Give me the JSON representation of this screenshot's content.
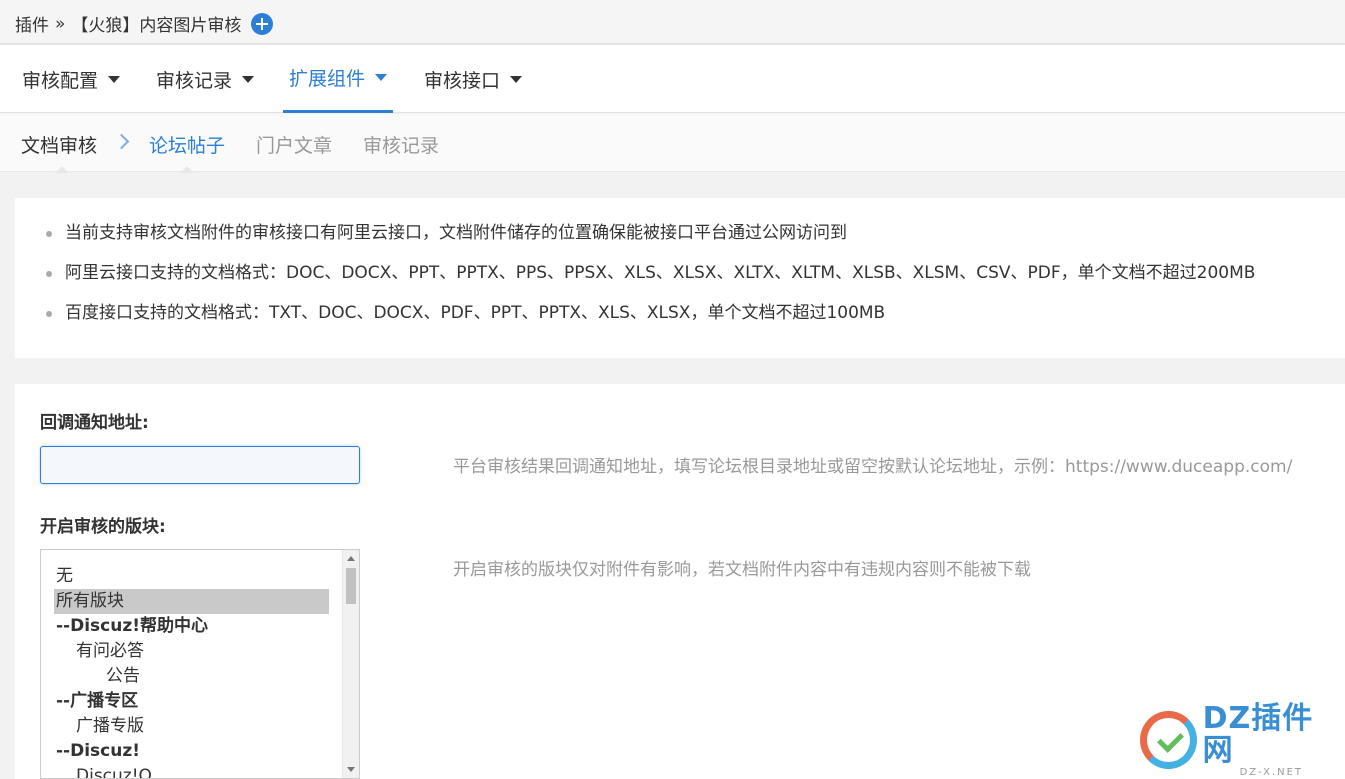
{
  "breadcrumb": {
    "root": "插件",
    "separator": "»",
    "current": "【火狼】内容图片审核"
  },
  "main_nav": [
    {
      "label": "审核配置",
      "active": false
    },
    {
      "label": "审核记录",
      "active": false
    },
    {
      "label": "扩展组件",
      "active": true
    },
    {
      "label": "审核接口",
      "active": false
    }
  ],
  "sub_nav": {
    "first": "文档审核",
    "items": [
      {
        "label": "论坛帖子",
        "active": true
      },
      {
        "label": "门户文章",
        "active": false
      },
      {
        "label": "审核记录",
        "active": false
      }
    ]
  },
  "notes": [
    "当前支持审核文档附件的审核接口有阿里云接口，文档附件储存的位置确保能被接口平台通过公网访问到",
    "阿里云接口支持的文档格式：DOC、DOCX、PPT、PPTX、PPS、PPSX、XLS、XLSX、XLTX、XLTM、XLSB、XLSM、CSV、PDF，单个文档不超过200MB",
    "百度接口支持的文档格式：TXT、DOC、DOCX、PDF、PPT、PPTX、XLS、XLSX，单个文档不超过100MB"
  ],
  "form": {
    "callback": {
      "label": "回调通知地址:",
      "value": "",
      "hint": "平台审核结果回调通知地址，填写论坛根目录地址或留空按默认论坛地址，示例：https://www.duceapp.com/"
    },
    "forums": {
      "label": "开启审核的版块:",
      "hint": "开启审核的版块仅对附件有影响，若文档附件内容中有违规内容则不能被下载",
      "options": [
        {
          "label": "无",
          "level": 0,
          "group": false,
          "selected": false
        },
        {
          "label": "所有版块",
          "level": 0,
          "group": false,
          "selected": true
        },
        {
          "label": "--Discuz!帮助中心",
          "level": 0,
          "group": true,
          "selected": false
        },
        {
          "label": "有问必答",
          "level": 1,
          "group": false,
          "selected": false
        },
        {
          "label": "公告",
          "level": 2,
          "group": false,
          "selected": false
        },
        {
          "label": "--广播专区",
          "level": 0,
          "group": true,
          "selected": false
        },
        {
          "label": "广播专版",
          "level": 1,
          "group": false,
          "selected": false
        },
        {
          "label": "--Discuz!",
          "level": 0,
          "group": true,
          "selected": false
        },
        {
          "label": "Discuz!Q",
          "level": 1,
          "group": false,
          "selected": false
        }
      ]
    }
  },
  "watermark": {
    "main": "DZ插件网",
    "sub": "DZ-X.NET"
  },
  "colors": {
    "accent": "#2d7fd6",
    "page_bg": "#f2f2f2",
    "hint_text": "#999999"
  }
}
